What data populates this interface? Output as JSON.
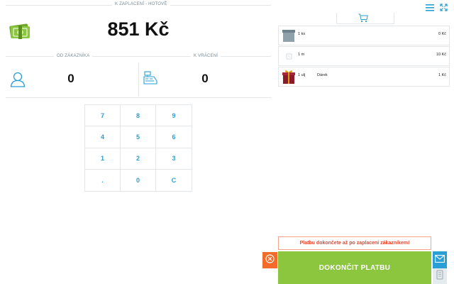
{
  "payment": {
    "to_pay_label": "K ZAPLACENÍ - HOTOVĚ",
    "amount": "851 Kč",
    "from_customer_label": "OD ZÁKAZNÍKA",
    "from_customer_value": "0",
    "change_label": "K VRÁCENÍ",
    "change_value": "0"
  },
  "keypad": {
    "keys": [
      "7",
      "8",
      "9",
      "4",
      "5",
      "6",
      "1",
      "2",
      "3",
      ".",
      "0",
      "C"
    ]
  },
  "cart": {
    "items": [
      {
        "qty": "1 ks",
        "name": "",
        "price": "0 Kč",
        "thumb": "gray-box-icon"
      },
      {
        "qty": "1 m",
        "name": "",
        "price": "10 Kč",
        "thumb": "blank-box-icon"
      },
      {
        "qty": "1 ulj",
        "name": "Dárek",
        "price": "1 Kč",
        "thumb": "gift-icon"
      }
    ]
  },
  "footer": {
    "warning": "Platbu dokončete až po zaplacení zákazníkem!",
    "finish_label": "DOKONČIT PLATBU"
  },
  "colors": {
    "accent_blue": "#2a9fd6",
    "finish_green": "#8cc63f",
    "cancel_orange": "#f26b2a",
    "warning_red": "#e8452a",
    "cash_green": "#8cc63f",
    "gift_red": "#8b1a2b"
  },
  "icons": {
    "cash": "cash-stack-icon",
    "customer": "user-icon",
    "change": "register-icon",
    "menu": "hamburger-menu-icon",
    "expand": "fullscreen-icon",
    "cart": "cart-icon",
    "cancel": "close-circle-icon",
    "mail": "mail-icon",
    "print": "print-icon"
  }
}
